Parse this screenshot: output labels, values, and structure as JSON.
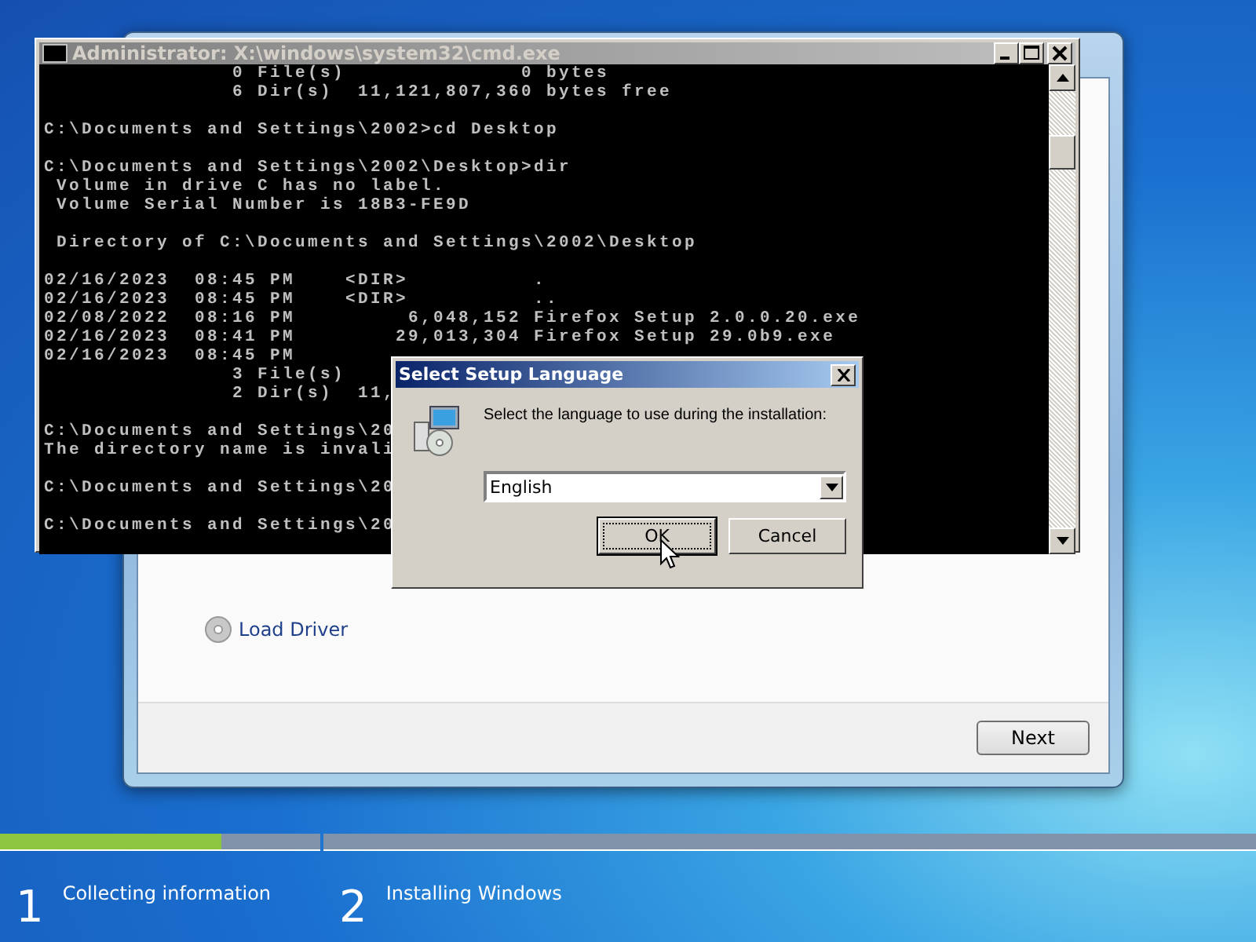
{
  "setup_window": {
    "links": [
      {
        "label": "Load Driver"
      }
    ],
    "next_button": "Next"
  },
  "console_window": {
    "title": "Administrator: X:\\windows\\system32\\cmd.exe",
    "blocks": [
      [
        "               0 File(s)              0 bytes",
        "               6 Dir(s)  11,121,807,360 bytes free"
      ],
      [
        "C:\\Documents and Settings\\2002>cd Desktop"
      ],
      [
        "C:\\Documents and Settings\\2002\\Desktop>dir",
        " Volume in drive C has no label.",
        " Volume Serial Number is 18B3-FE9D"
      ],
      [
        " Directory of C:\\Documents and Settings\\2002\\Desktop"
      ],
      [
        "02/16/2023  08:45 PM    <DIR>          .",
        "02/16/2023  08:45 PM    <DIR>          ..",
        "02/08/2022  08:16 PM         6,048,152 Firefox Setup 2.0.0.20.exe",
        "02/16/2023  08:41 PM        29,013,304 Firefox Setup 29.0b9.exe",
        "02/16/2023  08:45 PM",
        "               3 File(s)",
        "               2 Dir(s)  11,"
      ],
      [
        "C:\\Documents and Settings\\20",
        "The directory name is invali"
      ],
      [
        "C:\\Documents and Settings\\20"
      ],
      [
        "C:\\Documents and Settings\\20"
      ]
    ]
  },
  "language_dialog": {
    "title": "Select Setup Language",
    "prompt": "Select the language to use during the installation:",
    "language_select": {
      "value": "English"
    },
    "buttons": [
      {
        "label": "OK",
        "default": true
      },
      {
        "label": "Cancel",
        "default": false
      }
    ]
  },
  "progress": {
    "steps": [
      {
        "number": "1",
        "label": "Collecting information",
        "level": 0.69
      },
      {
        "number": "2",
        "label": "Installing Windows",
        "level": 0
      }
    ]
  }
}
